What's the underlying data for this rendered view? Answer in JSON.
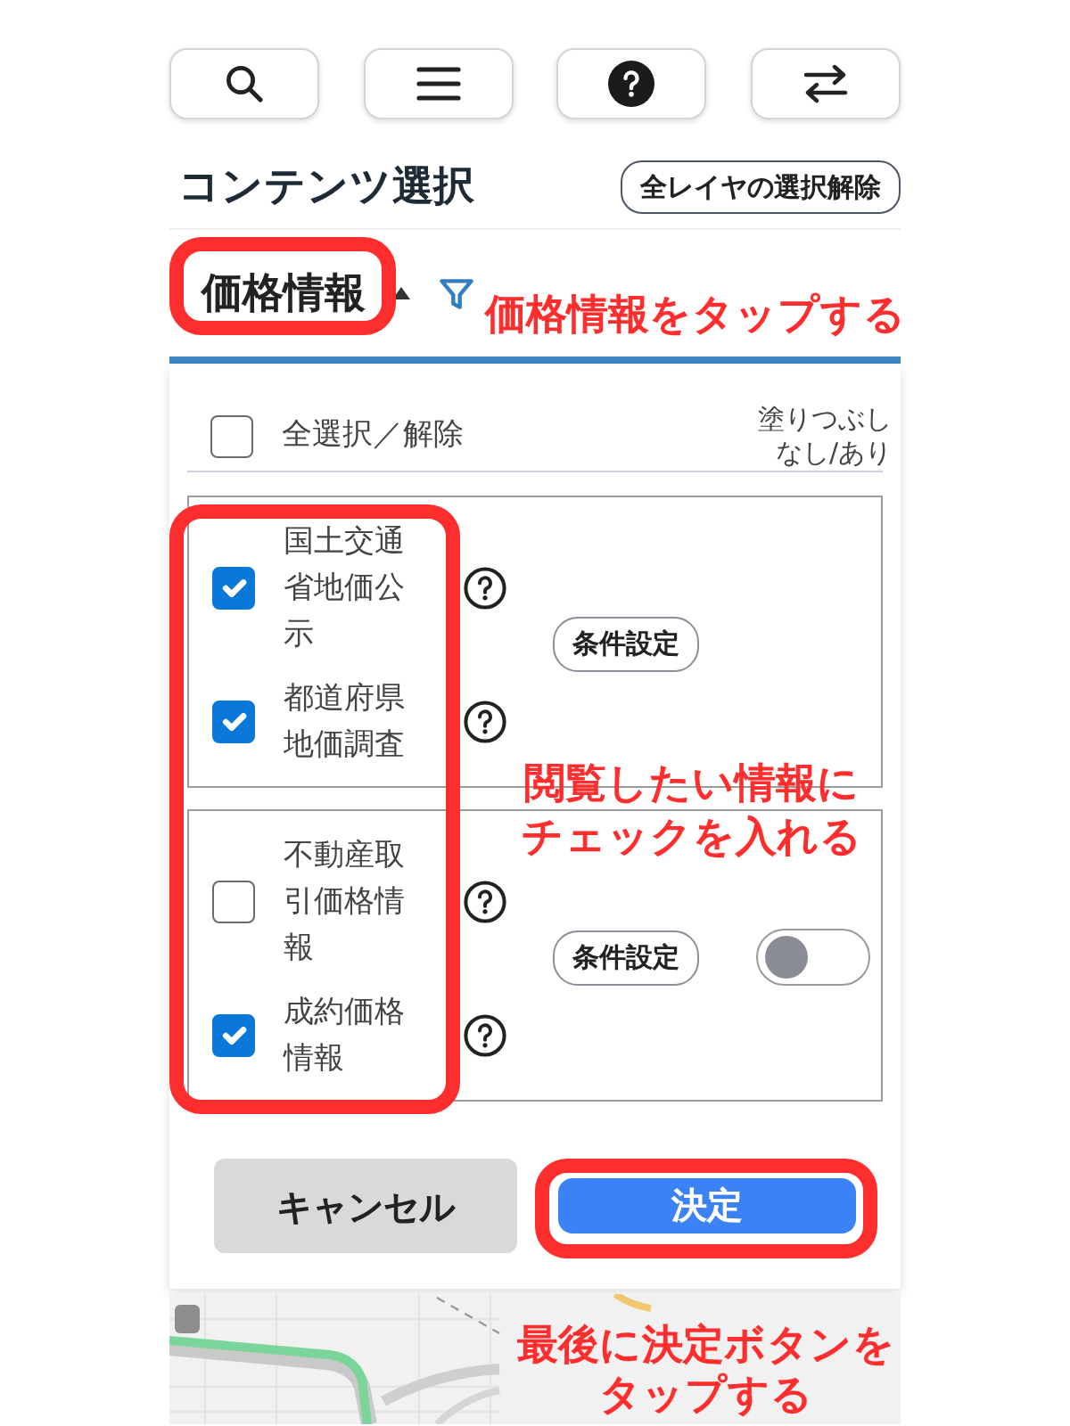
{
  "title": "コンテンツ選択",
  "clear_all_button": "全レイヤの選択解除",
  "category": {
    "label": "価格情報",
    "expanded": true,
    "selected": true
  },
  "select_all": {
    "label": "全選択／解除",
    "checked": false
  },
  "fill_header": "塗りつぶしなし/あり",
  "groups": [
    {
      "items": [
        {
          "label": "国土交通省地価公示",
          "checked": true
        },
        {
          "label": "都道府県地価調査",
          "checked": true
        }
      ],
      "condition_button": "条件設定"
    },
    {
      "items": [
        {
          "label": "不動産取引価格情報",
          "checked": false
        },
        {
          "label": "成約価格情報",
          "checked": true
        }
      ],
      "condition_button": "条件設定",
      "fill_toggle": {
        "on": false
      }
    }
  ],
  "buttons": [
    {
      "label": "キャンセル",
      "kind": "cancel"
    },
    {
      "label": "決定",
      "kind": "primary"
    }
  ],
  "annotations": [
    {
      "text": "価格情報をタップする"
    },
    {
      "text": "閲覧したい情報にチェックを入れる"
    },
    {
      "text": "最後に決定ボタンをタップする"
    }
  ]
}
